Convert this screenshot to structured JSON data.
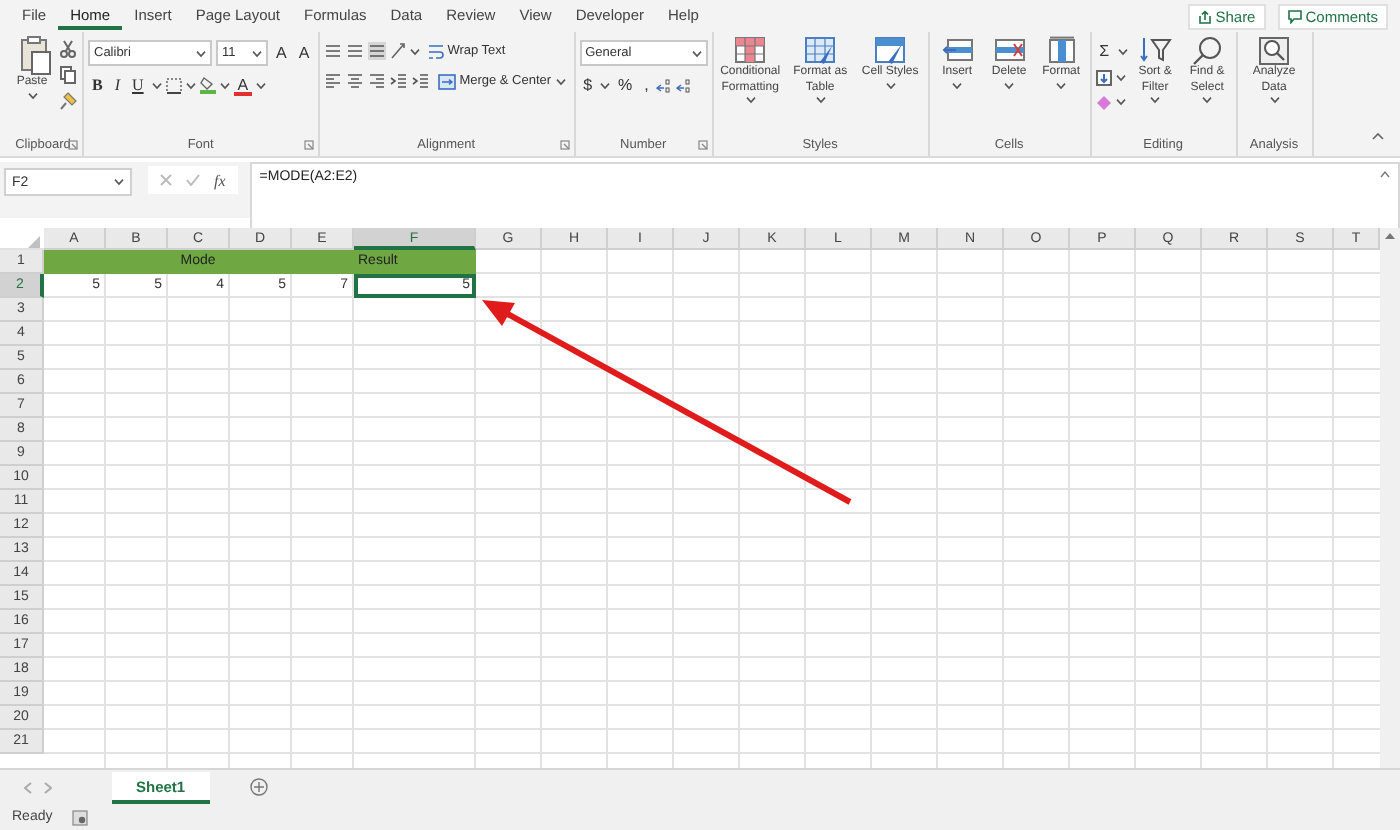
{
  "menu_tabs": [
    {
      "label": "File",
      "selected": false
    },
    {
      "label": "Home",
      "selected": true
    },
    {
      "label": "Insert",
      "selected": false
    },
    {
      "label": "Page Layout",
      "selected": false
    },
    {
      "label": "Formulas",
      "selected": false
    },
    {
      "label": "Data",
      "selected": false
    },
    {
      "label": "Review",
      "selected": false
    },
    {
      "label": "View",
      "selected": false
    },
    {
      "label": "Developer",
      "selected": false
    },
    {
      "label": "Help",
      "selected": false
    }
  ],
  "actions": [
    {
      "kind": "share",
      "label": "Share"
    },
    {
      "kind": "comments",
      "label": "Comments"
    }
  ],
  "ribbon": [
    {
      "kind": "clipboard",
      "label": "Clipboard",
      "launcher": true,
      "paste": "Paste"
    },
    {
      "kind": "font",
      "label": "Font",
      "launcher": true,
      "font_name": "Calibri",
      "font_size": "11",
      "grow": "A",
      "shrink": "A",
      "styles": [
        "B",
        "I",
        "U"
      ],
      "font_color": "A"
    },
    {
      "kind": "alignment",
      "label": "Alignment",
      "launcher": true,
      "wrap": "Wrap Text",
      "merge": "Merge & Center"
    },
    {
      "kind": "number",
      "label": "Number",
      "launcher": true,
      "format": "General",
      "symbols": [
        "$",
        "%",
        ","
      ]
    },
    {
      "kind": "buttons",
      "label": "Styles",
      "launcher": false,
      "buttons": [
        {
          "label": "Conditional Formatting"
        },
        {
          "label": "Format as Table"
        },
        {
          "label": "Cell Styles"
        }
      ]
    },
    {
      "kind": "buttons",
      "label": "Cells",
      "launcher": false,
      "buttons": [
        {
          "label": "Insert"
        },
        {
          "label": "Delete"
        },
        {
          "label": "Format"
        }
      ]
    },
    {
      "kind": "editing",
      "label": "Editing",
      "launcher": false,
      "sum": "Σ",
      "buttons": [
        {
          "label": "Sort & Filter"
        },
        {
          "label": "Find & Select"
        }
      ]
    },
    {
      "kind": "buttons",
      "label": "Analysis",
      "launcher": false,
      "buttons": [
        {
          "label": "Analyze Data"
        }
      ]
    }
  ],
  "formula_bar": {
    "name_box": "F2",
    "function_label": "fx",
    "formula": "=MODE(A2:E2)"
  },
  "columns": [
    {
      "label": "A",
      "selected": false
    },
    {
      "label": "B",
      "selected": false
    },
    {
      "label": "C",
      "selected": false
    },
    {
      "label": "D",
      "selected": false
    },
    {
      "label": "E",
      "selected": false
    },
    {
      "label": "F",
      "selected": true
    },
    {
      "label": "G",
      "selected": false
    },
    {
      "label": "H",
      "selected": false
    },
    {
      "label": "I",
      "selected": false
    },
    {
      "label": "J",
      "selected": false
    },
    {
      "label": "K",
      "selected": false
    },
    {
      "label": "L",
      "selected": false
    },
    {
      "label": "M",
      "selected": false
    },
    {
      "label": "N",
      "selected": false
    },
    {
      "label": "O",
      "selected": false
    },
    {
      "label": "P",
      "selected": false
    },
    {
      "label": "Q",
      "selected": false
    },
    {
      "label": "R",
      "selected": false
    },
    {
      "label": "S",
      "selected": false
    },
    {
      "label": "T",
      "selected": false
    }
  ],
  "rows": [
    {
      "header": "1",
      "selected": false,
      "cells": [
        {
          "text": "Mode",
          "kind": "heading",
          "selected": false
        },
        {
          "text": "Result",
          "kind": "heading",
          "selected": false
        }
      ]
    },
    {
      "header": "2",
      "selected": true,
      "cells": [
        {
          "text": "5",
          "kind": "number",
          "selected": false
        },
        {
          "text": "5",
          "kind": "number",
          "selected": false
        },
        {
          "text": "4",
          "kind": "number",
          "selected": false
        },
        {
          "text": "5",
          "kind": "number",
          "selected": false
        },
        {
          "text": "7",
          "kind": "number",
          "selected": false
        },
        {
          "text": "5",
          "kind": "number",
          "selected": true
        }
      ]
    },
    {
      "header": "3",
      "selected": false
    },
    {
      "header": "4",
      "selected": false
    },
    {
      "header": "5",
      "selected": false
    },
    {
      "header": "6",
      "selected": false
    },
    {
      "header": "7",
      "selected": false
    },
    {
      "header": "8",
      "selected": false
    },
    {
      "header": "9",
      "selected": false
    },
    {
      "header": "10",
      "selected": false
    },
    {
      "header": "11",
      "selected": false
    },
    {
      "header": "12",
      "selected": false
    },
    {
      "header": "13",
      "selected": false
    },
    {
      "header": "14",
      "selected": false
    },
    {
      "header": "15",
      "selected": false
    },
    {
      "header": "16",
      "selected": false
    },
    {
      "header": "17",
      "selected": false
    },
    {
      "header": "18",
      "selected": false
    },
    {
      "header": "19",
      "selected": false
    },
    {
      "header": "20",
      "selected": false
    },
    {
      "header": "21",
      "selected": false
    }
  ],
  "sheet_tabs": [
    {
      "label": "Sheet1",
      "selected": true
    }
  ],
  "status_bar": {
    "text": "Ready"
  }
}
